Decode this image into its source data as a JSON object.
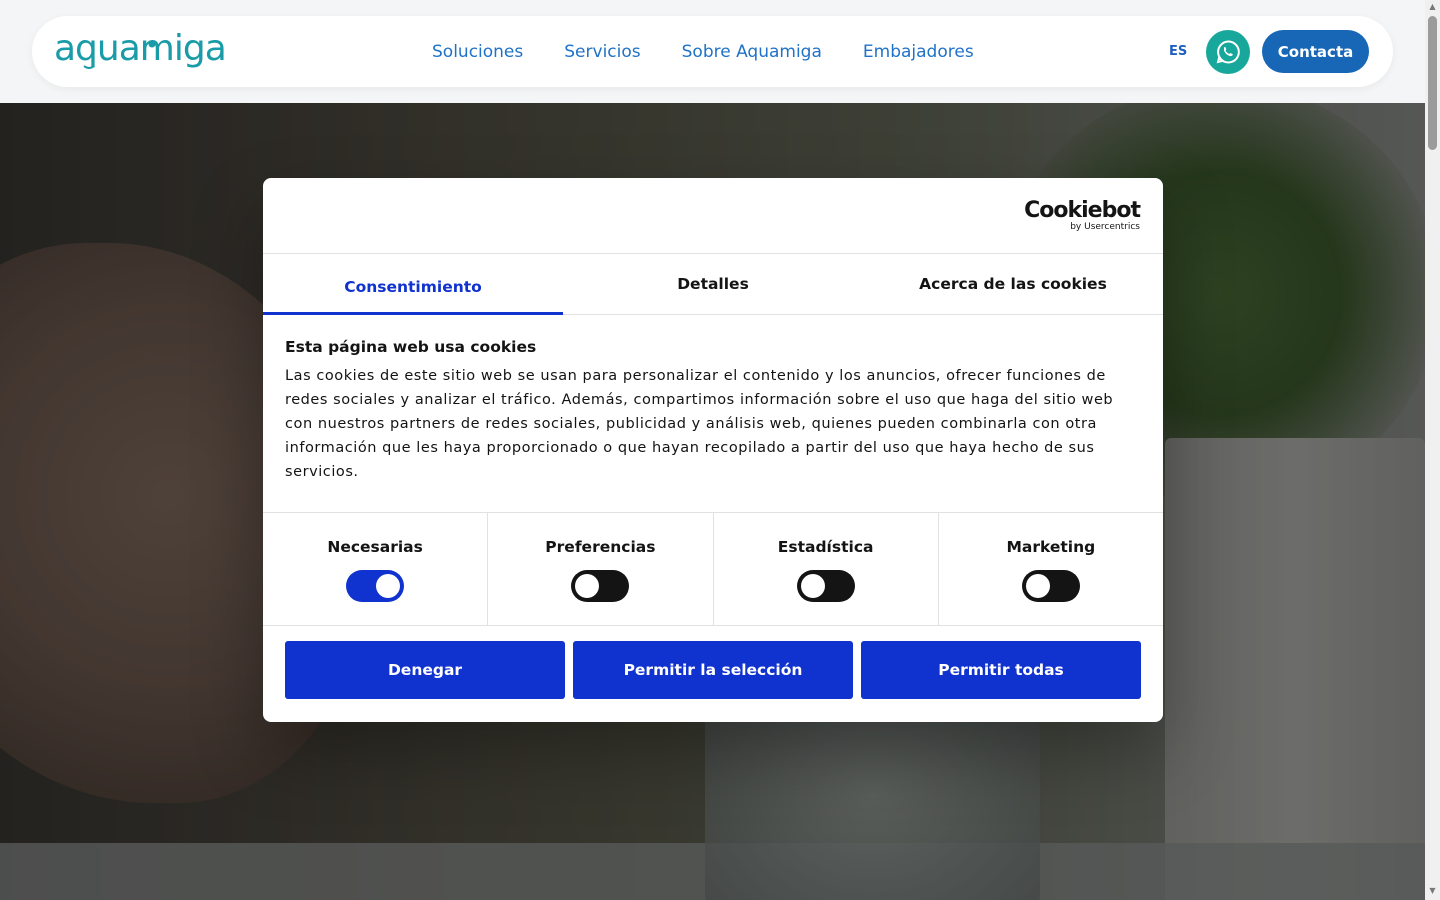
{
  "header": {
    "logo_text": "aquamiga",
    "nav": [
      "Soluciones",
      "Servicios",
      "Sobre Aquamiga",
      "Embajadores"
    ],
    "language": "ES",
    "contact_label": "Contacta"
  },
  "cookie_dialog": {
    "brand": "Cookiebot",
    "brand_sub": "by Usercentrics",
    "tabs": [
      "Consentimiento",
      "Detalles",
      "Acerca de las cookies"
    ],
    "title": "Esta página web usa cookies",
    "body": "Las cookies de este sitio web se usan para personalizar el contenido y los anuncios, ofrecer funciones de redes sociales y analizar el tráfico. Además, compartimos información sobre el uso que haga del sitio web con nuestros partners de redes sociales, publicidad y análisis web, quienes pueden combinarla con otra información que les haya proporcionado o que hayan recopilado a partir del uso que haya hecho de sus servicios.",
    "categories": [
      {
        "label": "Necesarias",
        "enabled": true
      },
      {
        "label": "Preferencias",
        "enabled": false
      },
      {
        "label": "Estadística",
        "enabled": false
      },
      {
        "label": "Marketing",
        "enabled": false
      }
    ],
    "buttons": [
      "Denegar",
      "Permitir la selección",
      "Permitir todas"
    ]
  },
  "colors": {
    "nav_link": "#1f72c8",
    "primary_blue": "#1032cf",
    "whatsapp": "#17a79b",
    "contact": "#1767b6"
  }
}
